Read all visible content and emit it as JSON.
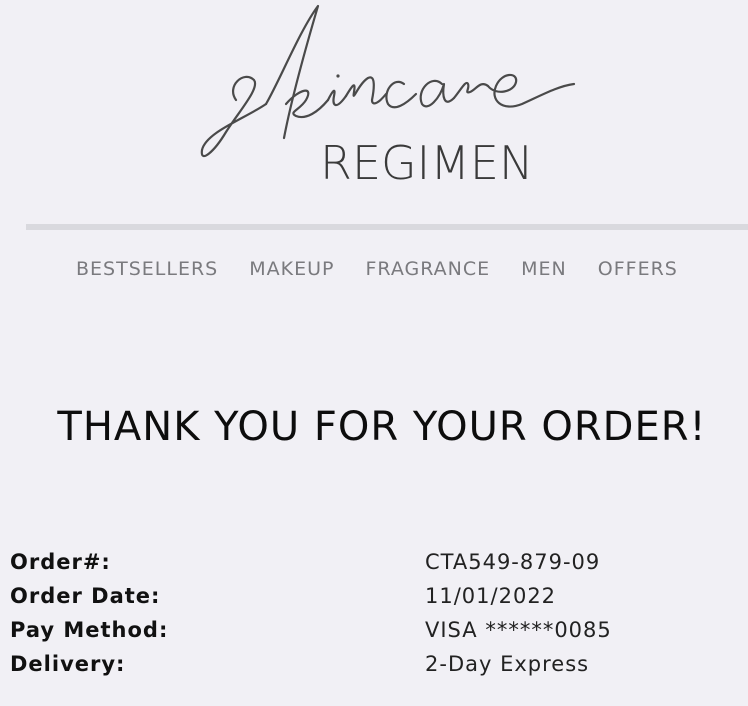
{
  "brand": {
    "logo_script": "skincare",
    "logo_word": "REGIMEN"
  },
  "nav": {
    "items": [
      "BESTSELLERS",
      "MAKEUP",
      "FRAGRANCE",
      "MEN",
      "OFFERS"
    ]
  },
  "headline": "THANK YOU FOR YOUR ORDER!",
  "order": {
    "rows": [
      {
        "label": "Order#:",
        "value": "CTA549-879-09"
      },
      {
        "label": "Order Date:",
        "value": "11/01/2022"
      },
      {
        "label": "Pay Method:",
        "value": "VISA ******0085"
      },
      {
        "label": "Delivery:",
        "value": "2-Day Express"
      }
    ]
  },
  "colors": {
    "background": "#f1f0f5",
    "nav_text": "#7a7a7e",
    "logo": "#3a3a3a",
    "divider": "#d9d9de"
  }
}
